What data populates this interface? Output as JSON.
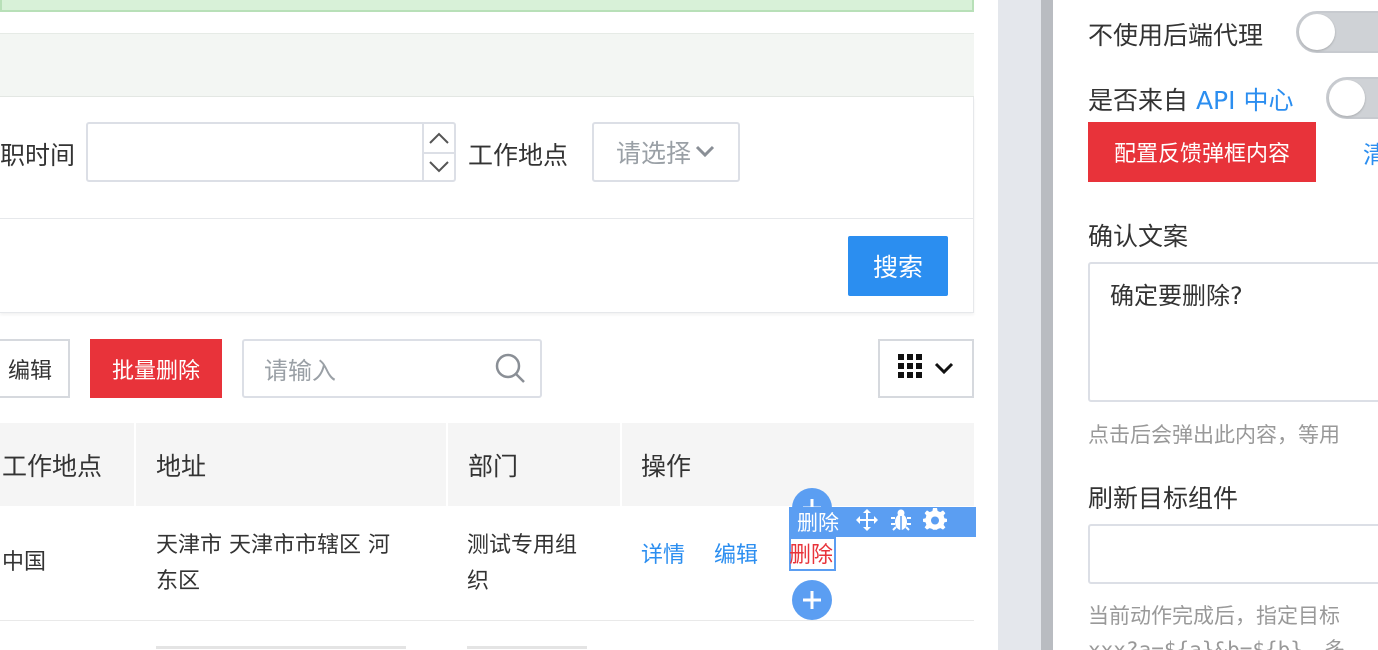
{
  "search_form": {
    "entry_time_label": "职时间",
    "work_location_label": "工作地点",
    "work_location_placeholder": "请选择",
    "search_button": "搜索"
  },
  "toolbar": {
    "edit_button": "编辑",
    "batch_delete_button": "批量删除",
    "search_placeholder": "请输入"
  },
  "table": {
    "columns": [
      "工作地点",
      "地址",
      "部门",
      "操作"
    ],
    "rows": [
      {
        "location": "中国",
        "address_line1": "天津市 天津市市辖区 河",
        "address_line2": "东区",
        "department_line1": "测试专用组",
        "department_line2": "织",
        "actions": [
          "详情",
          "编辑",
          "删除"
        ]
      }
    ]
  },
  "editor_overlay": {
    "label": "删除",
    "icons": [
      "move-icon",
      "bug-icon",
      "gear-icon",
      "plus-icon"
    ]
  },
  "panel": {
    "no_proxy_label": "不使用后端代理",
    "from_api_prefix": "是否来自 ",
    "from_api_link": "API 中心",
    "config_feedback_button": "配置反馈弹框内容",
    "clear_link": "清",
    "confirm_text_label": "确认文案",
    "confirm_text_value": "确定要删除?",
    "confirm_hint": "点击后会弹出此内容，等用",
    "refresh_target_label": "刷新目标组件",
    "refresh_hint": "当前动作完成后，指定目标",
    "refresh_hint2": "xxx?a=${a}&b=${b}，多",
    "switch_no_proxy": false,
    "switch_from_api": false
  },
  "colors": {
    "primary": "#2b8ef0",
    "danger": "#e8333a",
    "editor_highlight": "#5b9ef2"
  }
}
